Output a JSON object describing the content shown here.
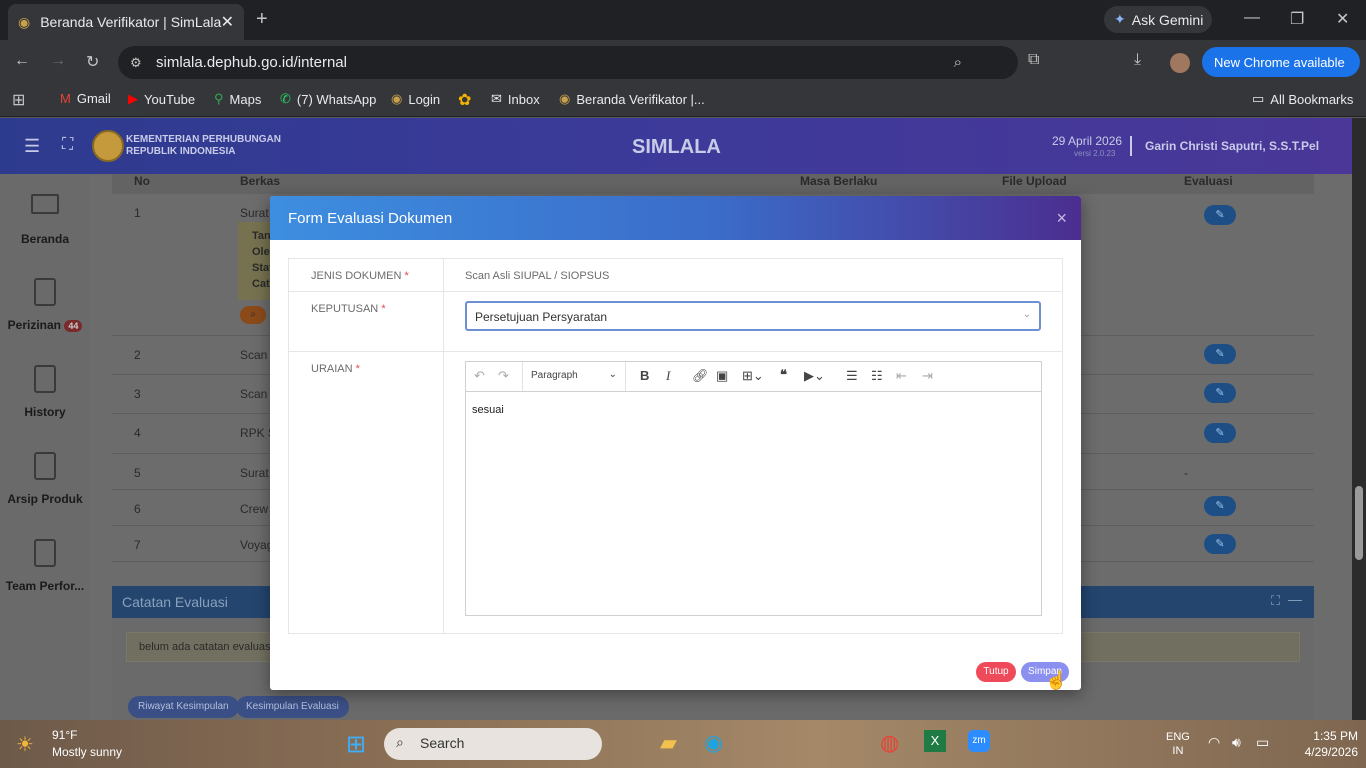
{
  "browser": {
    "tab_title": "Beranda Verifikator | SimLala",
    "url": "simlala.dephub.go.id/internal",
    "gemini_label": "Ask Gemini",
    "update_label": "New Chrome available",
    "bookmarks": [
      "Gmail",
      "YouTube",
      "Maps",
      "(7) WhatsApp",
      "Login",
      "Inbox",
      "Beranda Verifikator |..."
    ],
    "all_bookmarks": "All Bookmarks"
  },
  "app": {
    "org_line1": "KEMENTERIAN PERHUBUNGAN",
    "org_line2": "REPUBLIK INDONESIA",
    "title": "SIMLALA",
    "date": "29 April 2026",
    "version": "versi 2.0.23",
    "user": "Garin Christi Saputri, S.S.T.Pel"
  },
  "sidebar": {
    "items": [
      {
        "label": "Beranda"
      },
      {
        "label": "Perizinan",
        "badge": "44"
      },
      {
        "label": "History"
      },
      {
        "label": "Arsip Produk"
      },
      {
        "label": "Team Perfor..."
      }
    ]
  },
  "table": {
    "headers": [
      "No",
      "Berkas",
      "Masa Berlaku",
      "File Upload",
      "Evaluasi"
    ],
    "rows": [
      {
        "no": "1",
        "berkas": "Surat P",
        "eval": "✎"
      },
      {
        "no": "2",
        "berkas": "Scan A",
        "eval": "✎"
      },
      {
        "no": "3",
        "berkas": "Scan A",
        "eval": "✎"
      },
      {
        "no": "4",
        "berkas": "RPK Se",
        "eval": "✎"
      },
      {
        "no": "5",
        "berkas": "Surat D",
        "eval": "-"
      },
      {
        "no": "6",
        "berkas": "Crew li",
        "eval": "✎"
      },
      {
        "no": "7",
        "berkas": "Voyage",
        "eval": "✎"
      }
    ],
    "note_lines": [
      "Tan",
      "Ole",
      "Stat",
      "Cata"
    ]
  },
  "catatan": {
    "title": "Catatan Evaluasi",
    "empty": "belum ada catatan evaluasi",
    "btn_riwayat": "Riwayat Kesimpulan",
    "btn_kesimpulan": "Kesimpulan Evaluasi"
  },
  "modal": {
    "title": "Form Evaluasi Dokumen",
    "close": "×",
    "jenis_label": "JENIS DOKUMEN",
    "jenis_value": "Scan Asli SIUPAL / SIOPSUS",
    "keputusan_label": "KEPUTUSAN",
    "keputusan_value": "Persetujuan Persyaratan",
    "uraian_label": "URAIAN",
    "editor_format": "Paragraph",
    "editor_content": "sesuai",
    "btn_tutup": "Tutup",
    "btn_simpan": "Simpan"
  },
  "taskbar": {
    "temp": "91°F",
    "weather": "Mostly sunny",
    "search": "Search",
    "lang1": "ENG",
    "lang2": "IN",
    "time": "1:35 PM",
    "date": "4/29/2026"
  }
}
